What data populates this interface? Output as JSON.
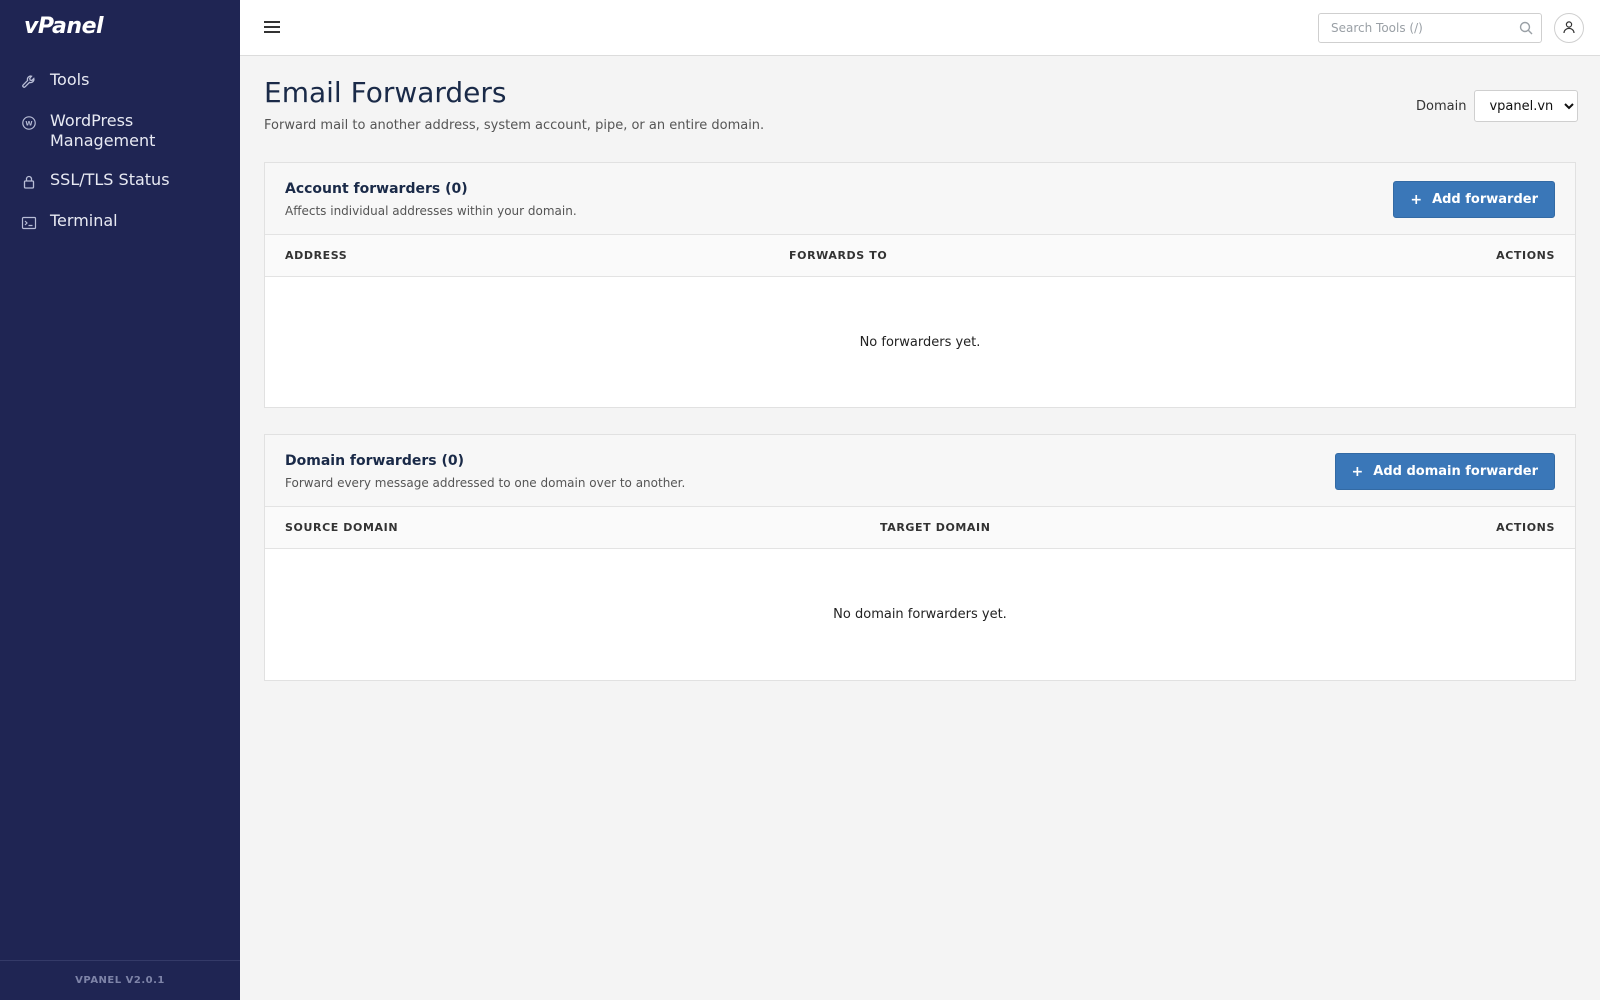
{
  "sidebar": {
    "logo": "vPanel",
    "items": [
      {
        "label": "Tools",
        "icon": "wrench-icon"
      },
      {
        "label": "WordPress Management",
        "icon": "wordpress-icon"
      },
      {
        "label": "SSL/TLS Status",
        "icon": "lock-icon"
      },
      {
        "label": "Terminal",
        "icon": "terminal-icon"
      }
    ],
    "version": "VPANEL V2.0.1"
  },
  "topbar": {
    "search_placeholder": "Search Tools (/)"
  },
  "page": {
    "title": "Email Forwarders",
    "subtitle": "Forward mail to another address, system account, pipe, or an entire domain.",
    "domain_label": "Domain",
    "domain_value": "vpanel.vn"
  },
  "account_forwarders": {
    "title": "Account forwarders (0)",
    "description": "Affects individual addresses within your domain.",
    "button_label": "Add forwarder",
    "columns": [
      "ADDRESS",
      "FORWARDS TO",
      "ACTIONS"
    ],
    "empty_text": "No forwarders yet."
  },
  "domain_forwarders": {
    "title": "Domain forwarders (0)",
    "description": "Forward every message addressed to one domain over to another.",
    "button_label": "Add domain forwarder",
    "columns": [
      "SOURCE DOMAIN",
      "TARGET DOMAIN",
      "ACTIONS"
    ],
    "empty_text": "No domain forwarders yet."
  },
  "colors": {
    "sidebar_bg": "#1f2553",
    "primary_button": "#3a77b8"
  }
}
